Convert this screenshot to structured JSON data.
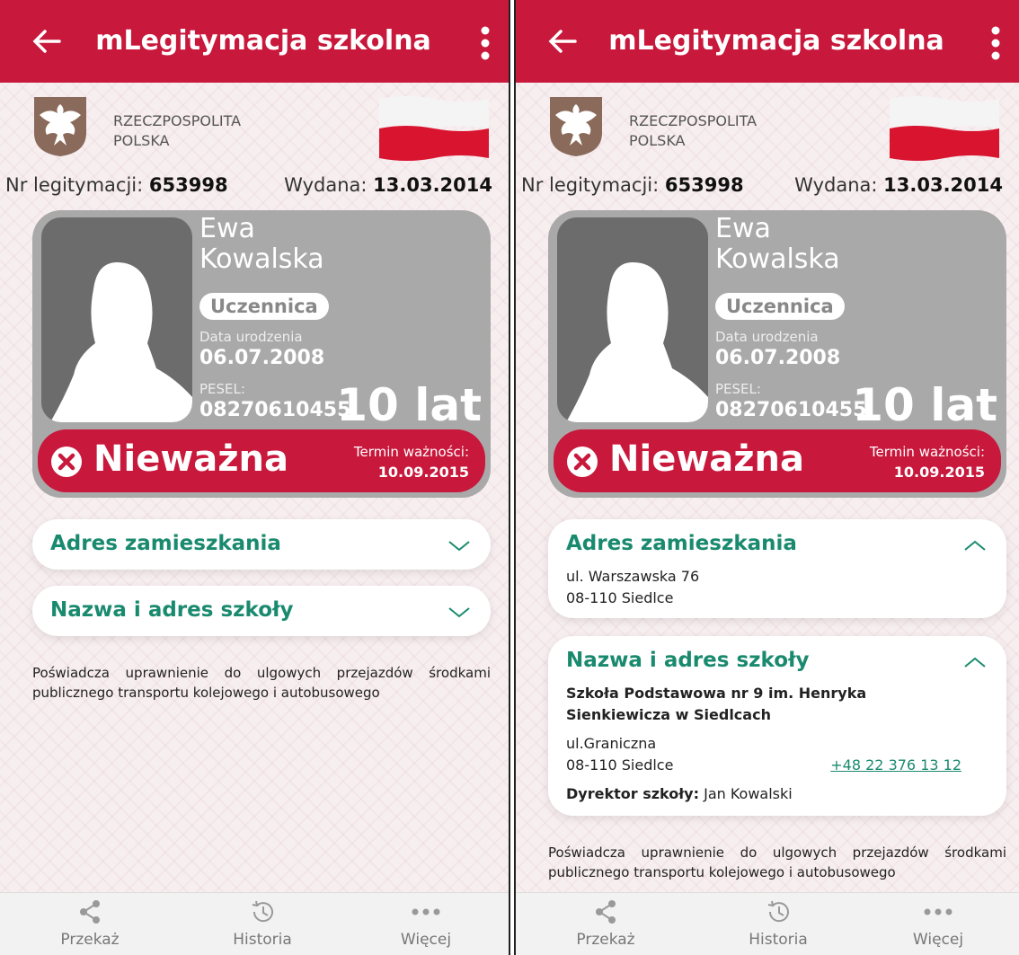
{
  "app_title": "mLegitymacja szkolna",
  "state_name_line1": "RZECZPOSPOLITA",
  "state_name_line2": "POLSKA",
  "card_number_label": "Nr legitymacji:",
  "card_number": "653998",
  "issued_label": "Wydana:",
  "issued_date": "13.03.2014",
  "person": {
    "first_name": "Ewa",
    "last_name": "Kowalska",
    "role": "Uczennica",
    "birth_label": "Data urodzenia",
    "birth_date": "06.07.2008",
    "pesel_label": "PESEL:",
    "pesel": "08270610455",
    "age": "10 lat"
  },
  "status": {
    "text": "Nieważna",
    "expiry_label": "Termin ważności:",
    "expiry_date": "10.09.2015"
  },
  "address_section": {
    "title": "Adres zamieszkania",
    "street": "ul. Warszawska 76",
    "city": "08-110 Siedlce"
  },
  "school_section": {
    "title": "Nazwa i adres szkoły",
    "name_line1": "Szkoła Podstawowa nr 9 im. Henryka",
    "name_line2": "Sienkiewicza w Siedlcach",
    "street": "ul.Graniczna",
    "city": "08-110 Siedlce",
    "phone": "+48 22 376 13 12",
    "director_label": "Dyrektor szkoły:",
    "director_name": "Jan Kowalski"
  },
  "footer_note": "Poświadcza uprawnienie do ulgowych przejazdów środkami publicznego transportu kolejowego i autobusowego",
  "nav": {
    "share": "Przekaż",
    "history": "Historia",
    "more": "Więcej"
  },
  "colors": {
    "brand_red": "#c8183c",
    "accent_green": "#1a8a6f",
    "card_gray": "#a9a9a9"
  }
}
